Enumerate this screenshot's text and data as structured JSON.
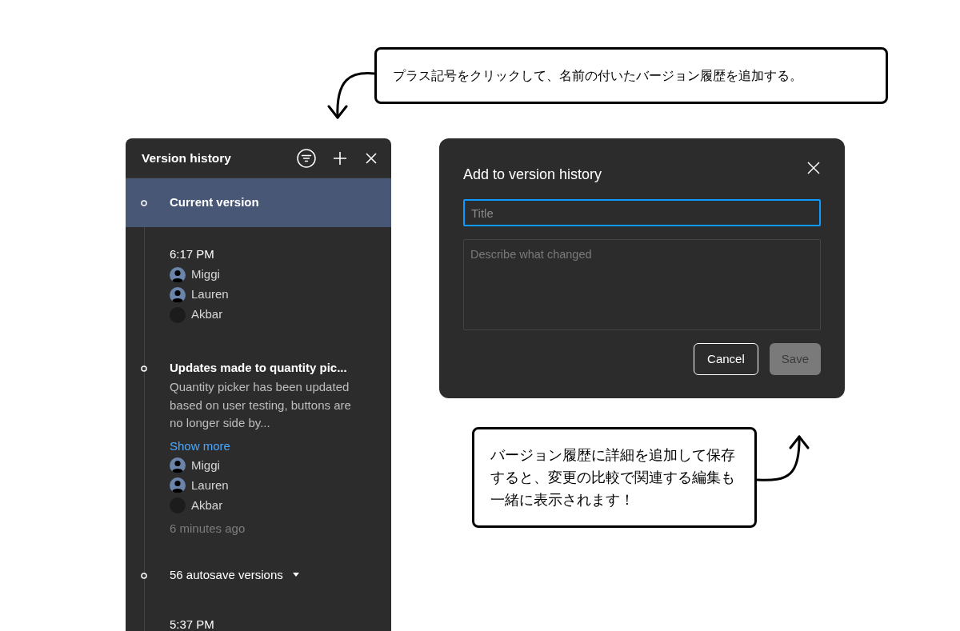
{
  "callouts": [
    {
      "kind": "top",
      "text": "プラス記号をクリックして、名前の付いたバージョン履歴を追加する。"
    },
    {
      "kind": "bottom",
      "text": "バージョン履歴に詳細を追加して保存すると、変更の比較で関連する編集も一緒に表示されます！"
    }
  ],
  "panel": {
    "title": "Version history",
    "entries": [
      {
        "kind": "named",
        "selected": true,
        "title": "Current version"
      },
      {
        "kind": "save",
        "selected": false,
        "title": "6:17 PM",
        "users": [
          {
            "kind": "default",
            "name": "Miggi"
          },
          {
            "kind": "default",
            "name": "Lauren"
          },
          {
            "kind": "photo",
            "name": "Akbar"
          }
        ]
      },
      {
        "kind": "named",
        "selected": false,
        "title": "Updates made to quantity pic...",
        "description": "Quantity picker has been updated based on user testing, buttons are no longer side by...",
        "link": "Show more",
        "users": [
          {
            "kind": "default",
            "name": "Miggi"
          },
          {
            "kind": "default",
            "name": "Lauren"
          },
          {
            "kind": "photo",
            "name": "Akbar"
          }
        ],
        "time": "6 minutes ago"
      },
      {
        "kind": "autosave",
        "selected": false,
        "title": "56 autosave versions"
      },
      {
        "kind": "save",
        "selected": false,
        "title": "5:37 PM"
      }
    ]
  },
  "dialog": {
    "title": "Add to version history",
    "title_field": {
      "placeholder": "Title",
      "focused": true
    },
    "description_field": {
      "placeholder": "Describe what changed"
    },
    "buttons": [
      {
        "kind": "secondary",
        "label": "Cancel",
        "disabled": false
      },
      {
        "kind": "primary",
        "label": "Save",
        "disabled": true
      }
    ]
  }
}
